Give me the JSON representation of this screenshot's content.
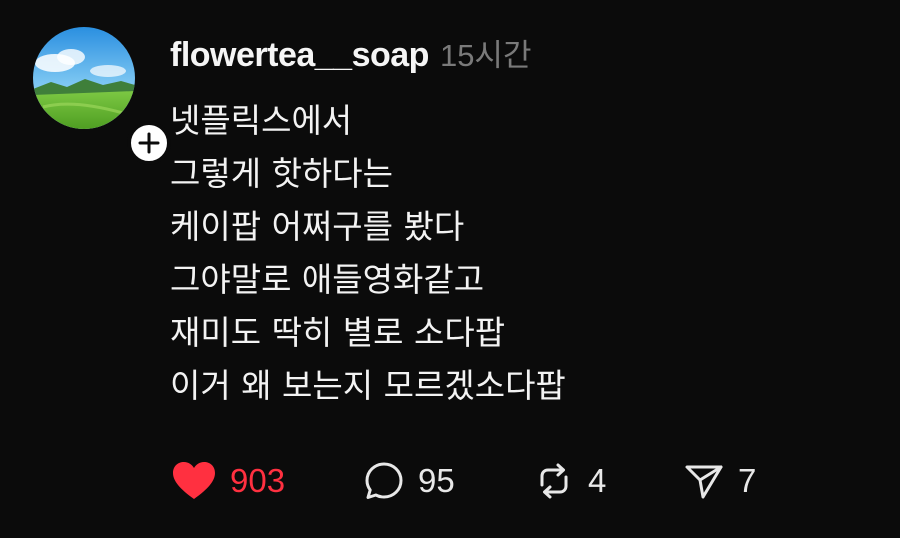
{
  "post": {
    "username": "flowertea__soap",
    "timestamp": "15시간",
    "lines": [
      "넷플릭스에서",
      "그렇게 핫하다는",
      "케이팝 어쩌구를 봤다",
      "그야말로 애들영화같고",
      "재미도 딱히 별로 소다팝",
      "이거 왜 보는지 모르겠소다팝"
    ],
    "actions": {
      "likes": "903",
      "comments": "95",
      "reposts": "4",
      "shares": "7"
    }
  },
  "icons": {
    "follow": "plus-icon",
    "like": "heart-icon",
    "comment": "comment-icon",
    "repost": "repost-icon",
    "share": "send-icon"
  },
  "colors": {
    "background": "#0b0b0b",
    "like_active": "#ff3040",
    "muted": "#7a7a7a"
  },
  "state": {
    "liked": true
  }
}
